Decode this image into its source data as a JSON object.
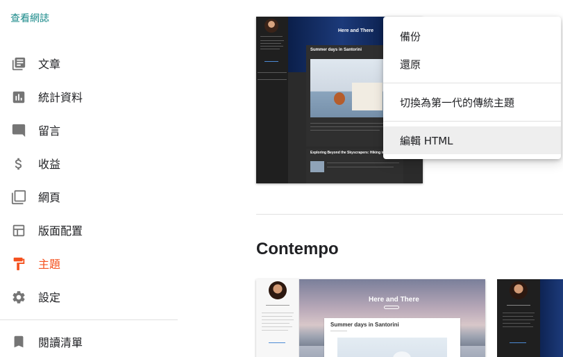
{
  "sidebar": {
    "view_blog": "查看網誌",
    "items": [
      {
        "label": "文章",
        "icon": "posts-icon"
      },
      {
        "label": "統計資料",
        "icon": "stats-icon"
      },
      {
        "label": "留言",
        "icon": "comments-icon"
      },
      {
        "label": "收益",
        "icon": "earnings-icon"
      },
      {
        "label": "網頁",
        "icon": "pages-icon"
      },
      {
        "label": "版面配置",
        "icon": "layout-icon"
      },
      {
        "label": "主題",
        "icon": "theme-icon",
        "active": true
      },
      {
        "label": "設定",
        "icon": "settings-icon"
      }
    ],
    "reading_list": "閱讀清單"
  },
  "main": {
    "current_theme_preview": {
      "blog_title": "Here and There",
      "post_title": "Summer days in Santorini",
      "post2_title": "Exploring Beyond the Skyscrapers: Hiking in Hon"
    },
    "section_title": "Contempo",
    "contempo_preview": {
      "blog_title": "Here and There",
      "post_title": "Summer days in Santorini"
    }
  },
  "menu": {
    "items": [
      {
        "label": "備份"
      },
      {
        "label": "還原"
      },
      {
        "label": "切換為第一代的傳統主題"
      },
      {
        "label": "編輯 HTML",
        "highlighted": true
      }
    ]
  },
  "colors": {
    "accent": "#f4511e",
    "link": "#1a8a8a",
    "icon": "#757575"
  }
}
